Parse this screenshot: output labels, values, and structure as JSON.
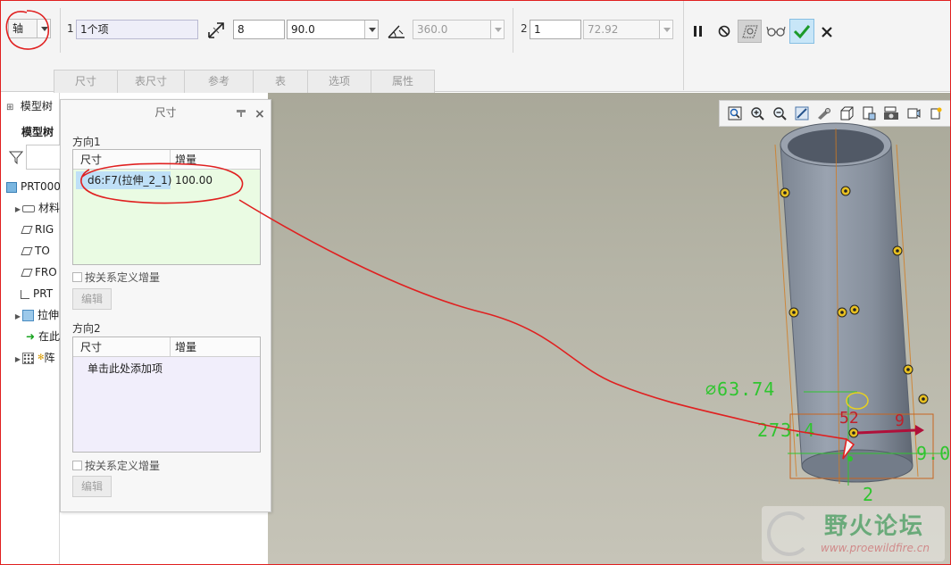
{
  "ribbon": {
    "mode_value": "轴",
    "field1_index": "1",
    "field1_value": "1个项",
    "count1_value": "8",
    "angle_value": "90.0",
    "full_angle_value": "360.0",
    "field2_index": "2",
    "count2_value": "1",
    "spacing2_value": "72.92"
  },
  "tabs": [
    {
      "label": "尺寸",
      "active": true
    },
    {
      "label": "表尺寸",
      "active": false
    },
    {
      "label": "参考",
      "active": false
    },
    {
      "label": "表",
      "active": false
    },
    {
      "label": "选项",
      "active": true
    },
    {
      "label": "属性",
      "active": true
    }
  ],
  "tree": {
    "header": "模型树",
    "subheader": "模型树",
    "items": [
      "PRT000",
      "材料",
      "RIG",
      "TO",
      "FRO",
      "PRT",
      "拉伸",
      "在此",
      "阵"
    ]
  },
  "panel": {
    "title": "尺寸",
    "direction1_label": "方向1",
    "direction1_col_dim": "尺寸",
    "direction1_col_inc": "增量",
    "direction1_rows": [
      {
        "dim": "d6:F7(拉伸_2_1)",
        "increment": "100.00"
      }
    ],
    "direction1_checkbox": "按关系定义增量",
    "direction1_edit": "编辑",
    "direction2_label": "方向2",
    "direction2_col_dim": "尺寸",
    "direction2_col_inc": "增量",
    "direction2_placeholder": "单击此处添加项",
    "direction2_checkbox": "按关系定义增量",
    "direction2_edit": "编辑"
  },
  "viewport": {
    "dim_diameter": "∅63.74",
    "dim_left": "273.4",
    "dim_right": "9.0",
    "dim_bottom": "2",
    "dim_red_a": "52",
    "dim_red_b": "9"
  },
  "watermark": {
    "title": "野火论坛",
    "url": "www.proewildfire.cn"
  },
  "colors": {
    "accent_annotation": "#e02020",
    "selection_highlight": "#bfe0f7",
    "dimension_green": "#2fc52f",
    "panel_dir1_bg": "#eafbe3",
    "panel_dir2_bg": "#f1eefb"
  }
}
